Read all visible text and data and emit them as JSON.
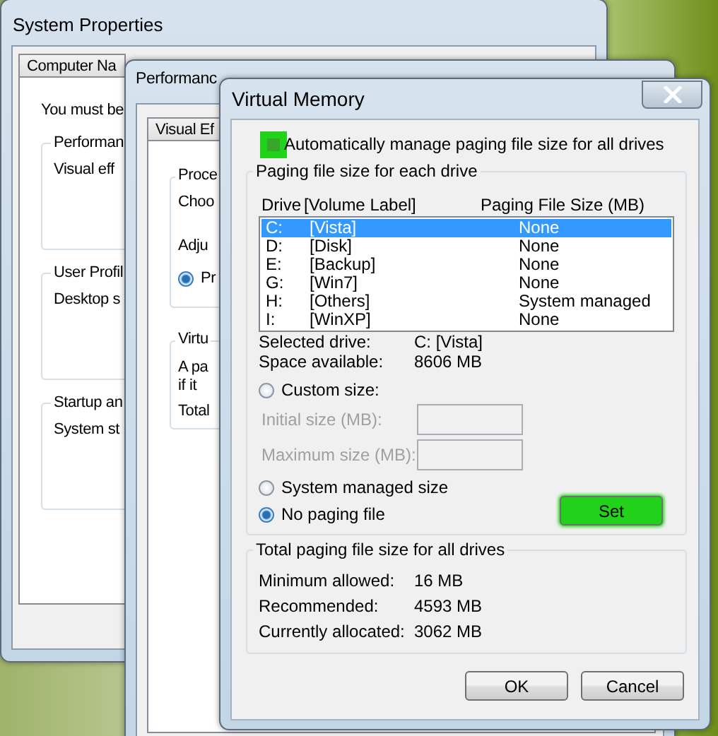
{
  "system_properties": {
    "title": "System Properties",
    "tabs": [
      {
        "label": "Computer Na",
        "selected": false
      }
    ],
    "intro": "You must be",
    "groups": [
      {
        "title": "Performan",
        "text": "Visual eff"
      },
      {
        "title": "User Profil",
        "text": "Desktop s"
      },
      {
        "title": "Startup an",
        "text": "System st"
      }
    ]
  },
  "performance_options": {
    "title": "Performanc",
    "tabs": [
      {
        "label": "Visual Ef",
        "selected": false
      }
    ],
    "groups": [
      {
        "title": "Proce",
        "lines": [
          "Choo",
          "Adju"
        ],
        "radio": {
          "label": "Pr",
          "selected": true
        }
      },
      {
        "title": "Virtu",
        "lines": [
          "A pa",
          "if it",
          "Total"
        ]
      }
    ]
  },
  "virtual_memory": {
    "title": "Virtual Memory",
    "auto_manage": {
      "label": "Automatically manage paging file size for all drives",
      "checked": false,
      "highlighted": true
    },
    "drives_group": {
      "title": "Paging file size for each drive",
      "columns": [
        "Drive",
        "[Volume Label]",
        "Paging File Size (MB)"
      ],
      "rows": [
        {
          "drive": "C:",
          "label": "[Vista]",
          "size": "None",
          "selected": true
        },
        {
          "drive": "D:",
          "label": "[Disk]",
          "size": "None",
          "selected": false
        },
        {
          "drive": "E:",
          "label": "[Backup]",
          "size": "None",
          "selected": false
        },
        {
          "drive": "G:",
          "label": "[Win7]",
          "size": "None",
          "selected": false
        },
        {
          "drive": "H:",
          "label": "[Others]",
          "size": "System managed",
          "selected": false
        },
        {
          "drive": "I:",
          "label": "[WinXP]",
          "size": "None",
          "selected": false
        }
      ],
      "info": [
        {
          "label": "Selected drive:",
          "value": "C:  [Vista]"
        },
        {
          "label": "Space available:",
          "value": "8606 MB"
        }
      ],
      "options": [
        {
          "kind": "radio",
          "label": "Custom size:",
          "selected": false
        },
        {
          "kind": "field",
          "label": "Initial size (MB):",
          "disabled": true
        },
        {
          "kind": "field",
          "label": "Maximum size (MB):",
          "disabled": true
        },
        {
          "kind": "radio",
          "label": "System managed size",
          "selected": false
        },
        {
          "kind": "radio",
          "label": "No paging file",
          "selected": true
        }
      ],
      "set_button": {
        "label": "Set",
        "highlighted": true
      }
    },
    "totals": {
      "title": "Total paging file size for all drives",
      "rows": [
        {
          "label": "Minimum allowed:",
          "value": "16 MB"
        },
        {
          "label": "Recommended:",
          "value": "4593 MB"
        },
        {
          "label": "Currently allocated:",
          "value": "3062 MB"
        }
      ]
    },
    "buttons": [
      {
        "label": "OK"
      },
      {
        "label": "Cancel"
      }
    ]
  }
}
